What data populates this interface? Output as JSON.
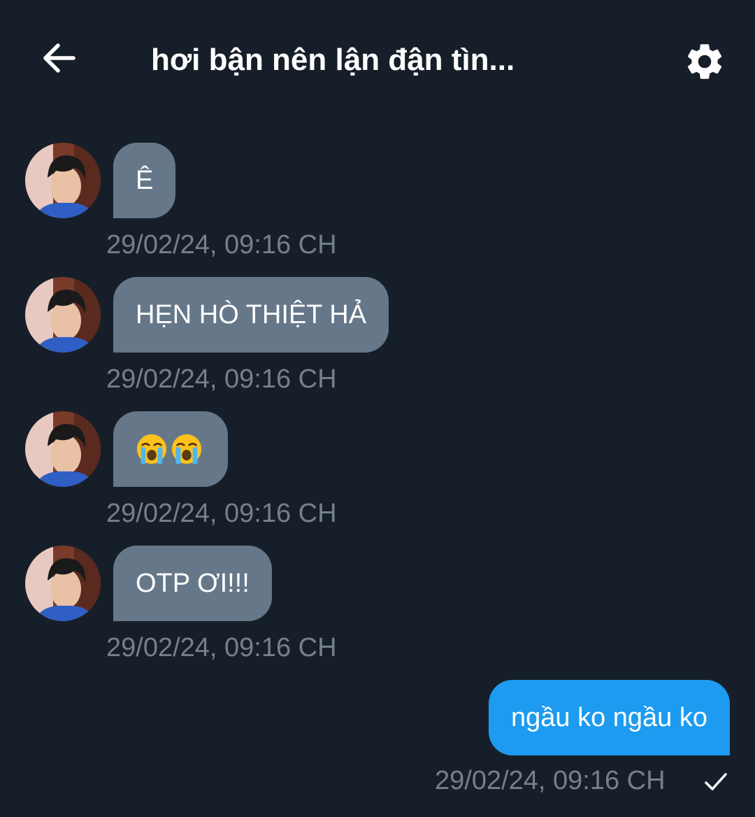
{
  "header": {
    "title": "hơi bận nên lận đận tìn...",
    "back_icon": "arrow-left-icon",
    "settings_icon": "gear-icon"
  },
  "messages": [
    {
      "direction": "incoming",
      "text": "Ê",
      "timestamp": "29/02/24, 09:16 CH"
    },
    {
      "direction": "incoming",
      "text": "HẸN HÒ THIỆT HẢ",
      "timestamp": "29/02/24, 09:16 CH"
    },
    {
      "direction": "incoming",
      "emoji": [
        "loudly-crying-face",
        "loudly-crying-face"
      ],
      "timestamp": "29/02/24, 09:16 CH"
    },
    {
      "direction": "incoming",
      "text": "OTP ƠI!!!",
      "timestamp": "29/02/24, 09:16 CH"
    },
    {
      "direction": "outgoing",
      "text": "ngầu ko ngầu ko",
      "timestamp": "29/02/24, 09:16 CH",
      "status_icon": "check-icon"
    }
  ],
  "colors": {
    "background": "#161f29",
    "incoming_bubble": "#66778a",
    "outgoing_bubble": "#1d9bf0",
    "timestamp": "#75808c"
  }
}
